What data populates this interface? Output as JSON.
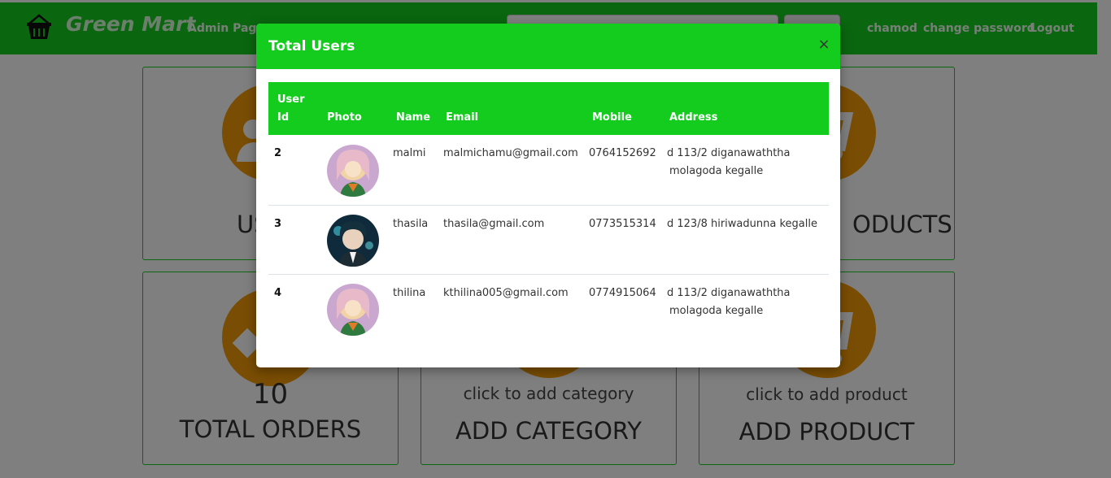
{
  "navbar": {
    "brand": "Green Mart",
    "admin_link": "Admin Page",
    "user": "chamod",
    "change_password": "change password",
    "logout": "Logout",
    "brand_color": "#14cc1e"
  },
  "cards": {
    "users": {
      "title_partial_left": "US",
      "icon": "users-icon"
    },
    "products": {
      "title_partial_right": "ODUCTS",
      "icon": "cart-icon"
    },
    "orders": {
      "value": "10",
      "title": "TOTAL ORDERS",
      "icon": "tag-icon"
    },
    "add_category": {
      "subtitle": "click to add category",
      "title": "ADD CATEGORY",
      "icon": "folder-icon"
    },
    "add_product": {
      "subtitle": "click to add product",
      "title": "ADD PRODUCT",
      "icon": "cart-add-icon"
    }
  },
  "modal": {
    "title": "Total Users",
    "close_glyph": "×",
    "columns": [
      "User Id",
      "Photo",
      "Name",
      "Email",
      "Mobile",
      "Address"
    ],
    "users": [
      {
        "id": "2",
        "name": "malmi",
        "email": "malmichamu@gmail.com",
        "mobile": "0764152692",
        "address_line1": "d 113/2 diganawaththa",
        "address_line2": "molagoda kegalle",
        "avatar": "avatar-girl-icon"
      },
      {
        "id": "3",
        "name": "thasila",
        "email": "thasila@gmail.com",
        "mobile": "0773515314",
        "address_line1": "d 123/8 hiriwadunna kegalle",
        "address_line2": "",
        "avatar": "avatar-boy-icon"
      },
      {
        "id": "4",
        "name": "thilina",
        "email": "kthilina005@gmail.com",
        "mobile": "0774915064",
        "address_line1": "d 113/2 diganawaththa",
        "address_line2": "molagoda kegalle",
        "avatar": "avatar-girl-icon"
      }
    ]
  },
  "colors": {
    "accent": "#14cc1e",
    "card_icon_bg": "#f29a06"
  }
}
